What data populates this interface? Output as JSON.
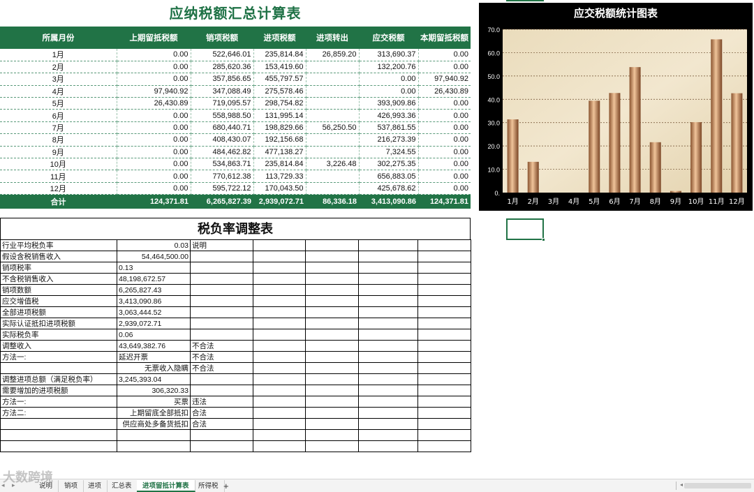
{
  "summary": {
    "title": "应纳税额汇总计算表",
    "headers": [
      "所属月份",
      "上期留抵税额",
      "销项税额",
      "进项税额",
      "进项转出",
      "应交税额",
      "本期留抵税额"
    ],
    "rows": [
      [
        "1月",
        "0.00",
        "522,646.01",
        "235,814.84",
        "26,859.20",
        "313,690.37",
        "0.00"
      ],
      [
        "2月",
        "0.00",
        "285,620.36",
        "153,419.60",
        "",
        "132,200.76",
        "0.00"
      ],
      [
        "3月",
        "0.00",
        "357,856.65",
        "455,797.57",
        "",
        "0.00",
        "97,940.92"
      ],
      [
        "4月",
        "97,940.92",
        "347,088.49",
        "275,578.46",
        "",
        "0.00",
        "26,430.89"
      ],
      [
        "5月",
        "26,430.89",
        "719,095.57",
        "298,754.82",
        "",
        "393,909.86",
        "0.00"
      ],
      [
        "6月",
        "0.00",
        "558,988.50",
        "131,995.14",
        "",
        "426,993.36",
        "0.00"
      ],
      [
        "7月",
        "0.00",
        "680,440.71",
        "198,829.66",
        "56,250.50",
        "537,861.55",
        "0.00"
      ],
      [
        "8月",
        "0.00",
        "408,430.07",
        "192,156.68",
        "",
        "216,273.39",
        "0.00"
      ],
      [
        "9月",
        "0.00",
        "484,462.82",
        "477,138.27",
        "",
        "7,324.55",
        "0.00"
      ],
      [
        "10月",
        "0.00",
        "534,863.71",
        "235,814.84",
        "3,226.48",
        "302,275.35",
        "0.00"
      ],
      [
        "11月",
        "0.00",
        "770,612.38",
        "113,729.33",
        "",
        "656,883.05",
        "0.00"
      ],
      [
        "12月",
        "0.00",
        "595,722.12",
        "170,043.50",
        "",
        "425,678.62",
        "0.00"
      ]
    ],
    "total": [
      "合计",
      "124,371.81",
      "6,265,827.39",
      "2,939,072.71",
      "86,336.18",
      "3,413,090.86",
      "124,371.81"
    ]
  },
  "chart_data": {
    "type": "bar",
    "title": "应交税额统计图表",
    "categories": [
      "1月",
      "2月",
      "3月",
      "4月",
      "5月",
      "6月",
      "7月",
      "8月",
      "9月",
      "10月",
      "11月",
      "12月"
    ],
    "values": [
      31.4,
      13.2,
      0,
      0,
      39.4,
      42.7,
      53.8,
      21.6,
      0.7,
      30.2,
      65.7,
      42.6
    ],
    "yticks": [
      "70.0",
      "60.0",
      "50.0",
      "40.0",
      "30.0",
      "20.0",
      "10.0",
      "0."
    ],
    "ylim": [
      0,
      70
    ],
    "grid": true,
    "background_color": "#000000",
    "bar_color": "#c98a5a"
  },
  "adjust": {
    "title": "税负率调整表",
    "rows": [
      [
        "行业平均税负率",
        "0.03",
        "说明"
      ],
      [
        "假设含税销售收入",
        "54,464,500.00",
        ""
      ],
      [
        "销项税率",
        "0.13",
        ""
      ],
      [
        "不含税销售收入",
        "48,198,672.57",
        ""
      ],
      [
        "销项数额",
        "6,265,827.43",
        ""
      ],
      [
        "应交增值税",
        "3,413,090.86",
        ""
      ],
      [
        "全部进项税额",
        "3,063,444.52",
        ""
      ],
      [
        "实际认证抵扣进项税额",
        "2,939,072.71",
        ""
      ],
      [
        "实际税负率",
        "0.06",
        ""
      ],
      [
        "调整收入",
        "43,649,382.76",
        "不合法"
      ],
      [
        "方法一:",
        "延迟开票",
        "不合法"
      ],
      [
        "",
        "无票收入隐瞒",
        "不合法"
      ],
      [
        "调整进项总额（满足税负率）",
        "3,245,393.04",
        ""
      ],
      [
        "需要增加的进项税额",
        "306,320.33",
        ""
      ],
      [
        "方法一:",
        "买票",
        "违法"
      ],
      [
        "方法二:",
        "上期留底全部抵扣",
        "合法"
      ],
      [
        "",
        "供应商处多备货抵扣",
        "合法"
      ],
      [
        "",
        "",
        ""
      ],
      [
        "",
        "",
        ""
      ]
    ],
    "text_cols": [
      false,
      false,
      true,
      true,
      true,
      true,
      true,
      true,
      true,
      true,
      true,
      false,
      true,
      false,
      false,
      false,
      false,
      false,
      false
    ]
  },
  "tabs": {
    "nav": "◂ ▸",
    "items": [
      "说明",
      "销项",
      "进项",
      "汇总表",
      "进项留抵计算表",
      "所得税"
    ],
    "active_index": 4,
    "add": "+"
  },
  "watermark": "大数跨境"
}
